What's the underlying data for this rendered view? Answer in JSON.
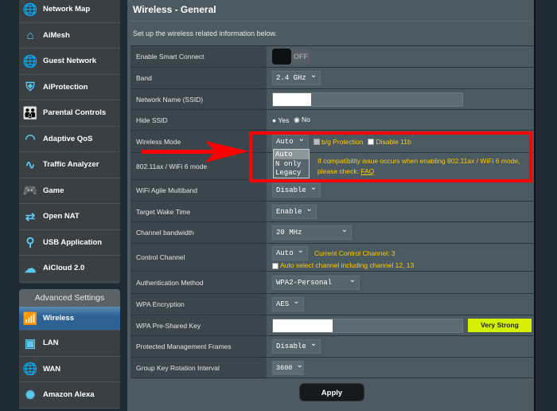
{
  "sidebar": {
    "items": [
      {
        "label": "Network Map",
        "icon": "globe-pin-icon"
      },
      {
        "label": "AiMesh",
        "icon": "mesh-icon"
      },
      {
        "label": "Guest Network",
        "icon": "guest-globe-icon"
      },
      {
        "label": "AiProtection",
        "icon": "shield-lock-icon"
      },
      {
        "label": "Parental Controls",
        "icon": "family-icon"
      },
      {
        "label": "Adaptive QoS",
        "icon": "gauge-icon"
      },
      {
        "label": "Traffic Analyzer",
        "icon": "pulse-icon"
      },
      {
        "label": "Game",
        "icon": "gamepad-icon"
      },
      {
        "label": "Open NAT",
        "icon": "nat-icon"
      },
      {
        "label": "USB Application",
        "icon": "usb-icon"
      },
      {
        "label": "AiCloud 2.0",
        "icon": "cloud-icon"
      }
    ],
    "advanced_header": "Advanced Settings",
    "advanced": [
      {
        "label": "Wireless",
        "icon": "wifi-icon",
        "active": true
      },
      {
        "label": "LAN",
        "icon": "lan-icon"
      },
      {
        "label": "WAN",
        "icon": "wan-globe-icon"
      },
      {
        "label": "Amazon Alexa",
        "icon": "alexa-icon"
      }
    ]
  },
  "main": {
    "title": "Wireless - General",
    "description": "Set up the wireless related information below.",
    "rows": {
      "smart_connect": {
        "label": "Enable Smart Connect",
        "toggle": "OFF"
      },
      "band": {
        "label": "Band",
        "value": "2.4 GHz"
      },
      "ssid": {
        "label": "Network Name (SSID)",
        "value": ""
      },
      "hide_ssid": {
        "label": "Hide SSID",
        "yes": "Yes",
        "no": "No",
        "selected": "No"
      },
      "wireless_mode": {
        "label": "Wireless Mode",
        "value": "Auto",
        "bg_protection": "b/g Protection",
        "bg_checked": true,
        "disable11b": "Disable 11b",
        "disable11b_checked": false,
        "options": [
          "Auto",
          "N only",
          "Legacy"
        ]
      },
      "ax_mode": {
        "label": "802.11ax / WiFi 6 mode",
        "note": "If compatibility issue occurs when enabling 802.11ax / WiFi 6 mode,",
        "note2": "please check:",
        "faq": "FAQ"
      },
      "agile": {
        "label": "WiFi Agile Multiband",
        "value": "Disable"
      },
      "twt": {
        "label": "Target Wake Time",
        "value": "Enable"
      },
      "bandwidth": {
        "label": "Channel bandwidth",
        "value": "20 MHz"
      },
      "control_channel": {
        "label": "Control Channel",
        "value": "Auto",
        "current": "Current Control Channel: 3",
        "auto_select": "Auto select channel including channel 12, 13"
      },
      "auth": {
        "label": "Authentication Method",
        "value": "WPA2-Personal"
      },
      "encryption": {
        "label": "WPA Encryption",
        "value": "AES"
      },
      "psk": {
        "label": "WPA Pre-Shared Key",
        "value": "",
        "strength": "Very Strong",
        "strength_color": "#d4f000"
      },
      "pmf": {
        "label": "Protected Management Frames",
        "value": "Disable"
      },
      "gkr": {
        "label": "Group Key Rotation Interval",
        "value": "3600"
      }
    },
    "apply": "Apply"
  },
  "annotation_color": "#ff0000"
}
